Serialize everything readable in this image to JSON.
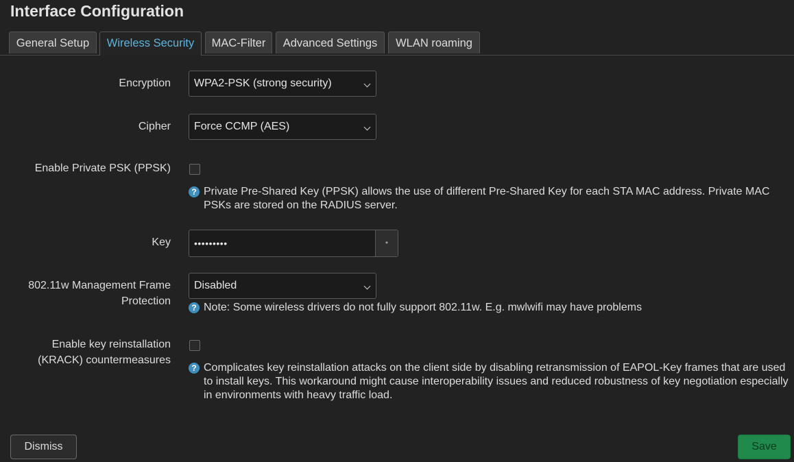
{
  "title": "Interface Configuration",
  "tabs": [
    {
      "label": "General Setup"
    },
    {
      "label": "Wireless Security"
    },
    {
      "label": "MAC-Filter"
    },
    {
      "label": "Advanced Settings"
    },
    {
      "label": "WLAN roaming"
    }
  ],
  "active_tab": "Wireless Security",
  "encryption": {
    "label": "Encryption",
    "value": "WPA2-PSK (strong security)"
  },
  "cipher": {
    "label": "Cipher",
    "value": "Force CCMP (AES)"
  },
  "ppsk": {
    "label": "Enable Private PSK (PPSK)",
    "checked": false,
    "help": "Private Pre-Shared Key (PPSK) allows the use of different Pre-Shared Key for each STA MAC address. Private MAC PSKs are stored on the RADIUS server."
  },
  "key": {
    "label": "Key",
    "value": "•••••••••",
    "reveal_button": "•"
  },
  "mfp": {
    "label_line1": "802.11w Management Frame",
    "label_line2": "Protection",
    "value": "Disabled",
    "help": "Note: Some wireless drivers do not fully support 802.11w. E.g. mwlwifi may have problems"
  },
  "krack": {
    "label_line1": "Enable key reinstallation",
    "label_line2": "(KRACK) countermeasures",
    "checked": false,
    "help": "Complicates key reinstallation attacks on the client side by disabling retransmission of EAPOL-Key frames that are used to install keys. This workaround might cause interoperability issues and reduced robustness of key negotiation especially in environments with heavy traffic load."
  },
  "buttons": {
    "dismiss": "Dismiss",
    "save": "Save"
  },
  "colors": {
    "accent": "#5fb3dc",
    "save": "#1f8a4c",
    "background": "#222222"
  }
}
